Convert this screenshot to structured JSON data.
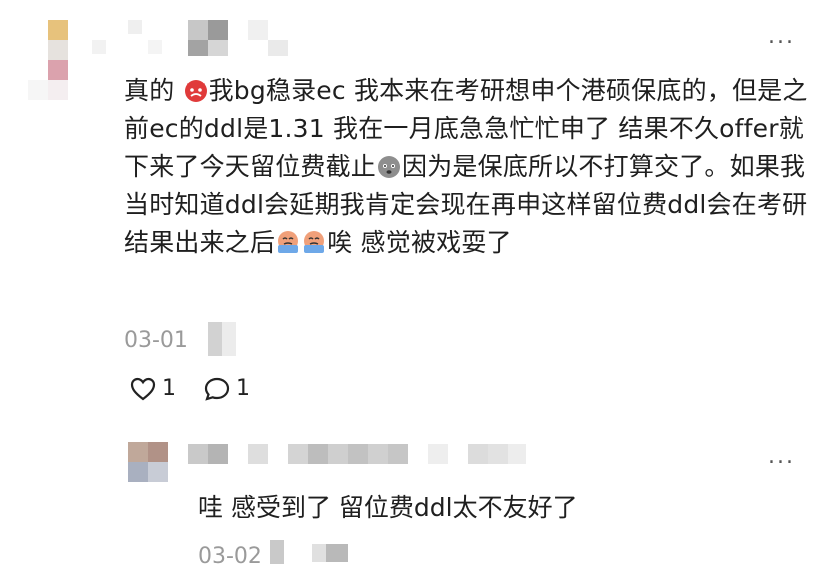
{
  "comment": {
    "text": "真的 {devil}我bg稳录ec 我本来在考研想申个港硕保底的，但是之前ec的ddl是1.31 我在一月底急急忙忙申了 结果不久offer就下来了今天留位费截止{sad}因为是保底所以不打算交了。如果我当时知道ddl会延期我肯定会现在再申这样留位费ddl会在考研结果出来之后{cry}{cry}唉 感觉被戏耍了",
    "text_segments": [
      "真的 ",
      "我bg稳录ec 我本来在考研想申个港硕保底的，但是之前ec的ddl是1.31 我在一月底急急忙忙申了 结果不久offer就下来了今天留位费截止",
      "因为是保底所以不打算交了。如果我当时知道ddl会延期我肯定会现在再申这样留位费ddl会在考研结果出来之后",
      "唉 感觉被戏耍了"
    ],
    "emojis": [
      "devil-emoji",
      "sad-emoji",
      "crying-emoji",
      "crying-emoji"
    ],
    "date": "03-01",
    "like_count": "1",
    "reply_count": "1",
    "more_label": "..."
  },
  "reply": {
    "text": "哇 感受到了 留位费ddl太不友好了",
    "date": "03-02",
    "more_label": "..."
  },
  "colors": {
    "text": "#1f1f1f",
    "meta": "#9a9a9a",
    "devil_emoji": "#e03a3a",
    "cry_emoji": "#f0a07a"
  }
}
